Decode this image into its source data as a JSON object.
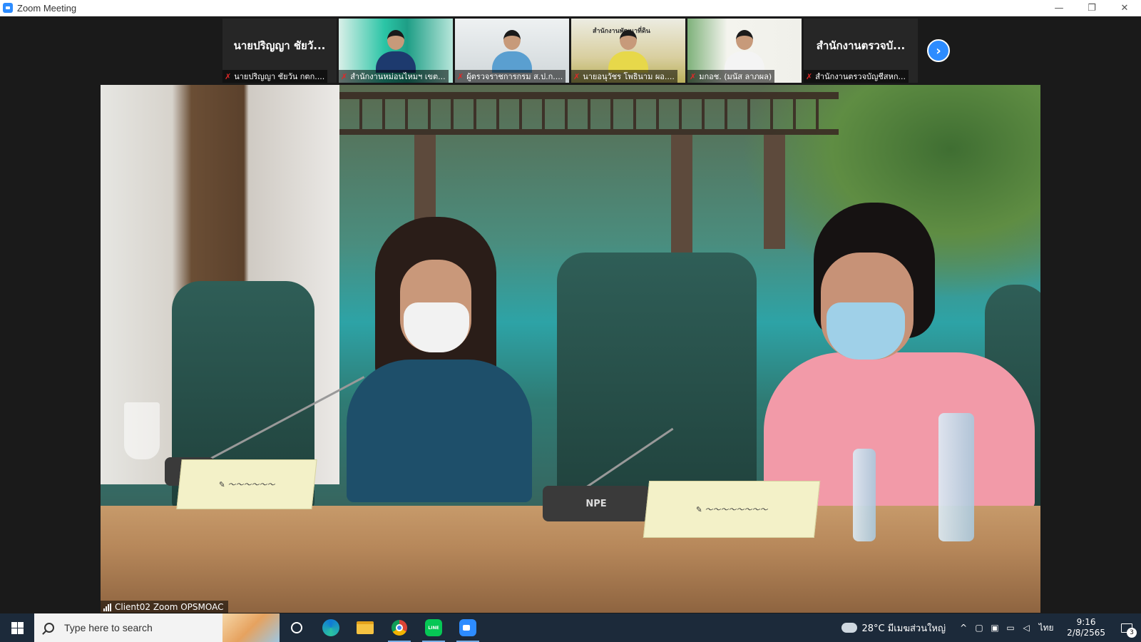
{
  "window": {
    "title": "Zoom Meeting",
    "controls": {
      "minimize": "—",
      "restore": "❐",
      "close": "✕"
    }
  },
  "participants": [
    {
      "display_name": "นายปริญญา ชัยวั...",
      "label": "นายปริญญา ชัยวัน กตก....",
      "muted": true,
      "video": false
    },
    {
      "label": "สำนักงานหม่อนไหมฯ เขต...",
      "muted": true,
      "video": true
    },
    {
      "label": "ผู้ตรวจราชการกรม ส.ป.ก....",
      "muted": true,
      "video": true
    },
    {
      "label": "นายอนุวัชร โพธินาม ผอ....",
      "muted": true,
      "video": true,
      "background_text": "สำนักงานพัฒนาที่ดิน"
    },
    {
      "label": "มกอช. (มนัส ลาภผล)",
      "muted": true,
      "video": true
    },
    {
      "display_name": "สำนักงานตรวจบั...",
      "label": "สำนักงานตรวจบัญชีสหก...",
      "muted": true,
      "video": false
    }
  ],
  "strip_next_icon": "chevron-right-icon",
  "main_video": {
    "label": "Client02 Zoom OPSMOAC",
    "signal_icon": "signal-strength-icon",
    "mic_brand": "NPE"
  },
  "taskbar": {
    "search_placeholder": "Type here to search",
    "apps": [
      "task-view-icon",
      "edge-icon",
      "file-explorer-icon",
      "chrome-icon",
      "line-icon",
      "zoom-icon"
    ],
    "weather": {
      "temp": "28°C",
      "desc": "มีเมฆส่วนใหญ่"
    },
    "language": "ไทย",
    "time": "9:16",
    "date": "2/8/2565",
    "notifications": "3"
  },
  "colors": {
    "zoom_blue": "#2d8cff",
    "mic_muted": "#e02828",
    "taskbar": "#1c2a3a"
  }
}
